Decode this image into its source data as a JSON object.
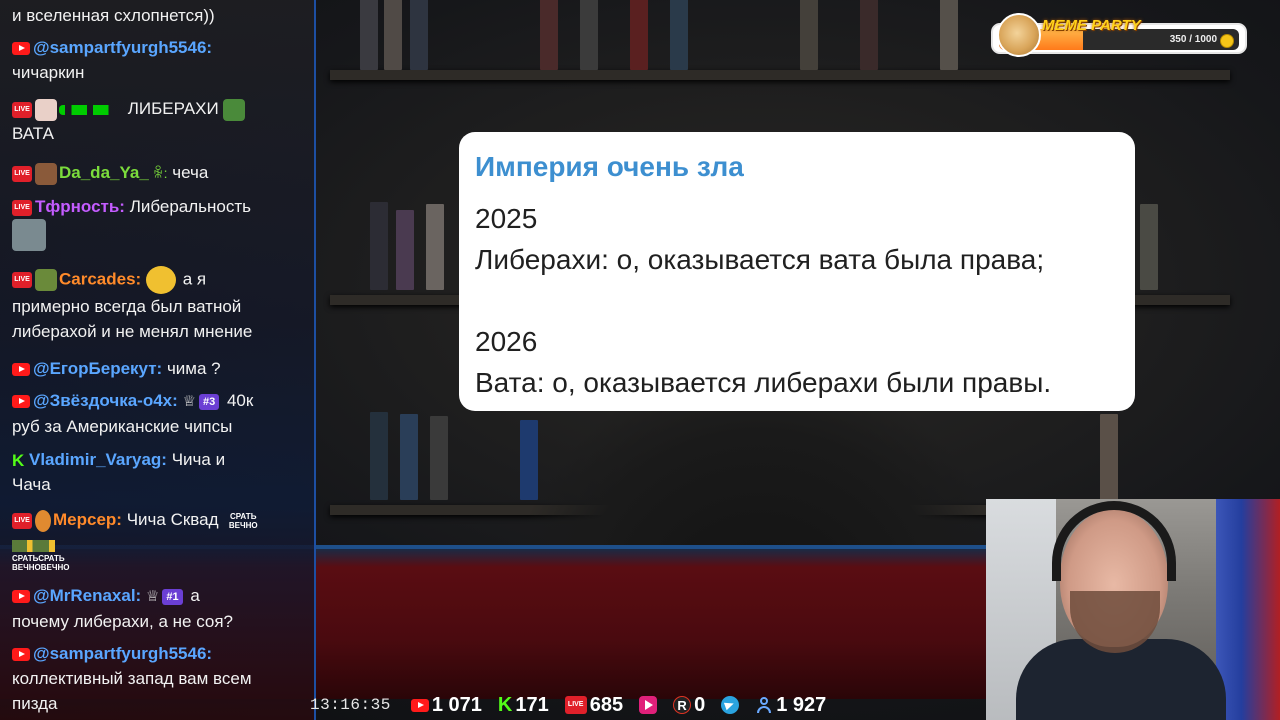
{
  "chat": {
    "messages": [
      {
        "nick": "",
        "text": "и вселенная схлопнется))",
        "nick_color": "#ffffff",
        "platform": "none"
      },
      {
        "nick": "@sampartfyurgh5546:",
        "text": "чичаркин",
        "nick_color": "#5aa6ff",
        "platform": "youtube"
      },
      {
        "nick": "",
        "text": "ЛИБЕРАХИ",
        "text2": "ВАТА",
        "nick_color": "#ffffff",
        "platform": "vk"
      },
      {
        "nick": "Da_da_Ya_",
        "text": "чеча",
        "nick_color": "#7bdc3c",
        "platform": "vk"
      },
      {
        "nick": "Тфрность:",
        "text": "Либеральность",
        "nick_color": "#c45cff",
        "platform": "vk"
      },
      {
        "nick": "Carcades:",
        "text": "а я",
        "text2": "примерно всегда был ватной",
        "text3": "либерахой и не менял мнение",
        "nick_color": "#ff8a2a",
        "platform": "vk"
      },
      {
        "nick": "@ЕгорБерекут:",
        "text": "чима ?",
        "nick_color": "#5aa6ff",
        "platform": "youtube"
      },
      {
        "nick": "@Звёздочка-о4х:",
        "badge": "#3",
        "text": "40к",
        "text2": "руб за Американские чипсы",
        "nick_color": "#5aa6ff",
        "platform": "youtube"
      },
      {
        "nick": "Vladimir_Varyag:",
        "text": "Чича и",
        "text2": "Чача",
        "nick_color": "#5aa6ff",
        "platform": "kick"
      },
      {
        "nick": "Мерсер:",
        "text": "Чича Сквад",
        "nick_color": "#ff8a2a",
        "platform": "vk"
      },
      {
        "nick": "@MrRenaxal:",
        "badge": "#1",
        "text": "а",
        "text2": "почему либерахи, а не соя?",
        "nick_color": "#5aa6ff",
        "platform": "youtube"
      },
      {
        "nick": "@sampartfyurgh5546:",
        "text": "коллективный запад вам всем",
        "text2": "пизда",
        "nick_color": "#5aa6ff",
        "platform": "youtube"
      }
    ],
    "emote_labels": {
      "srat_vechno": "СРАТЬ ВЕЧНО",
      "srat_row": "СРАТЬСРАТЬ ВЕЧНОВЕЧНО"
    }
  },
  "card": {
    "title": "Империя очень зла",
    "lines": [
      "2025",
      "Либерахи: о, оказывается вата была права;",
      "",
      "2026",
      "Вата: о, оказывается либерахи были правы."
    ]
  },
  "meme_party": {
    "title": "MEME PARTY",
    "count": "350 / 1000",
    "progress": 0.35
  },
  "stats": {
    "time": "13:16:35",
    "youtube": "1 071",
    "kick": "171",
    "vk": "685",
    "rumble": "0",
    "viewers": "1 927"
  },
  "colors": {
    "card_title": "#3d8fd0",
    "youtube": "#ff1a1a",
    "kick": "#53fc18",
    "vk": "#e0202a",
    "telegram": "#2aa3e0"
  }
}
